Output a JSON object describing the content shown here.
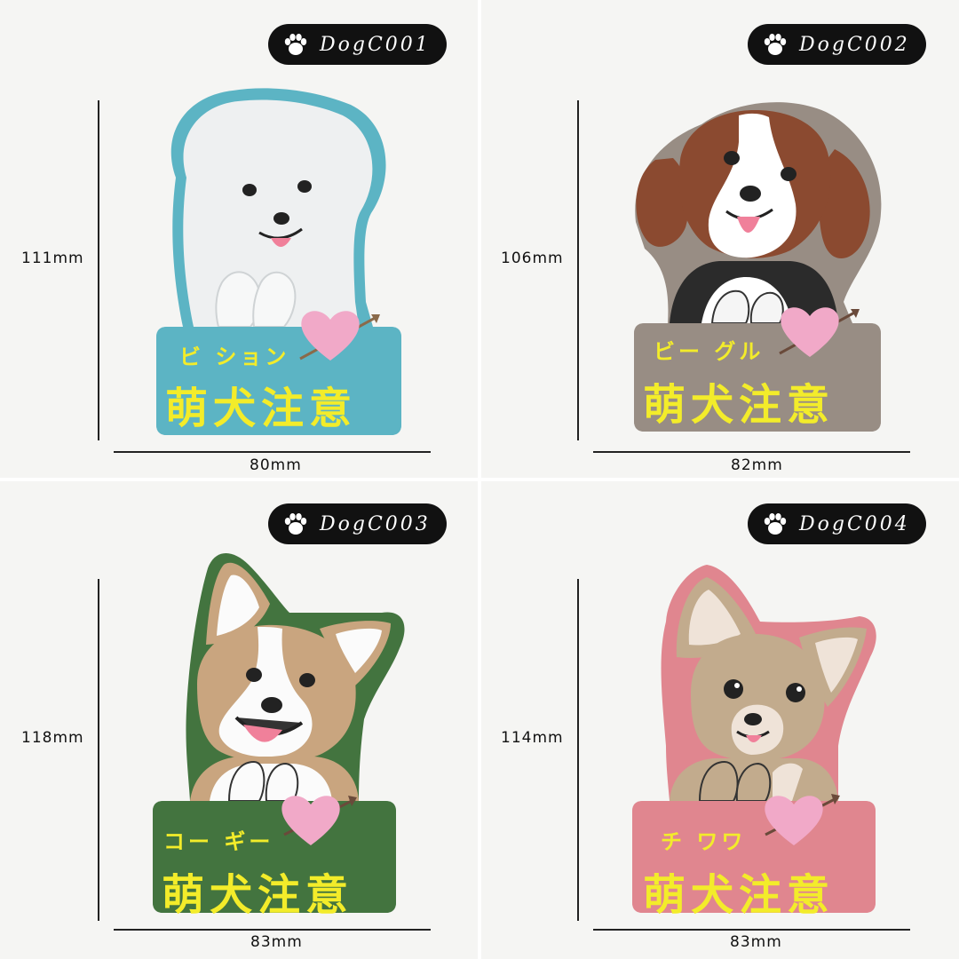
{
  "products": [
    {
      "code": "DogC001",
      "breed_label": "ビ ション",
      "warning": "萌犬注意",
      "height_label": "111mm",
      "width_label": "80mm",
      "colors": {
        "plate": "#5cb4c4",
        "fur": "#eef0f1",
        "outline": "#5cb4c4"
      }
    },
    {
      "code": "DogC002",
      "breed_label": "ビー グル",
      "warning": "萌犬注意",
      "height_label": "106mm",
      "width_label": "82mm",
      "colors": {
        "plate": "#988d84",
        "fur": "#8b4a30",
        "outline": "#988d84"
      }
    },
    {
      "code": "DogC003",
      "breed_label": "コー ギー",
      "warning": "萌犬注意",
      "height_label": "118mm",
      "width_label": "83mm",
      "colors": {
        "plate": "#43743f",
        "fur": "#c9a57f",
        "outline": "#43743f"
      }
    },
    {
      "code": "DogC004",
      "breed_label": "チ ワワ",
      "warning": "萌犬注意",
      "height_label": "114mm",
      "width_label": "83mm",
      "colors": {
        "plate": "#e0868f",
        "fur": "#c2ab8d",
        "outline": "#e0868f"
      }
    }
  ],
  "accent": {
    "text_yellow": "#f3ec2a",
    "heart_pink": "#f1a9c8",
    "badge_black": "#111111"
  },
  "icons": {
    "badge_icon": "paw-icon",
    "decor_icon": "heart-arrow-icon"
  }
}
